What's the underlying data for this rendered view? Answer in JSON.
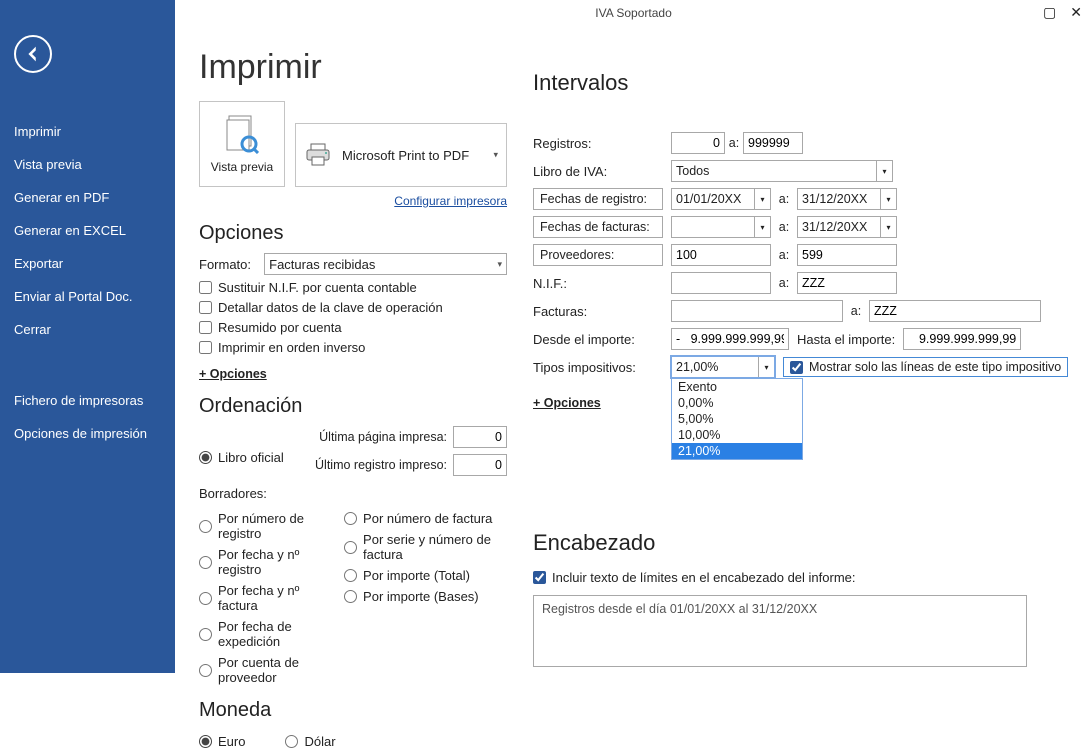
{
  "window": {
    "title": "IVA Soportado"
  },
  "sidebar": {
    "items": [
      {
        "label": "Imprimir"
      },
      {
        "label": "Vista previa"
      },
      {
        "label": "Generar en PDF"
      },
      {
        "label": "Generar en EXCEL"
      },
      {
        "label": "Exportar"
      },
      {
        "label": "Enviar al Portal Doc."
      },
      {
        "label": "Cerrar"
      }
    ],
    "items2": [
      {
        "label": "Fichero de impresoras"
      },
      {
        "label": "Opciones de impresión"
      }
    ]
  },
  "page": {
    "title": "Imprimir",
    "preview_label": "Vista previa",
    "printer_name": "Microsoft Print to PDF",
    "config_printer_link": "Configurar impresora"
  },
  "opciones": {
    "heading": "Opciones",
    "formato_label": "Formato:",
    "formato_value": "Facturas recibidas",
    "checks": [
      "Sustituir N.I.F. por cuenta contable",
      "Detallar datos de la clave de operación",
      "Resumido por cuenta",
      "Imprimir en orden inverso"
    ],
    "more": "+ Opciones"
  },
  "ordenacion": {
    "heading": "Ordenación",
    "libro_oficial": "Libro oficial",
    "ultima_pagina_label": "Última página impresa:",
    "ultima_pagina_value": "0",
    "ultimo_registro_label": "Último registro impreso:",
    "ultimo_registro_value": "0",
    "borradores_label": "Borradores:",
    "col1": [
      "Por número de registro",
      "Por fecha y nº registro",
      "Por fecha y nº factura",
      "Por fecha de expedición",
      "Por cuenta de proveedor"
    ],
    "col2": [
      "Por número de factura",
      "Por serie y número de factura",
      "Por importe (Total)",
      "Por importe (Bases)"
    ]
  },
  "moneda": {
    "heading": "Moneda",
    "euro": "Euro",
    "dolar": "Dólar"
  },
  "intervalos": {
    "heading": "Intervalos",
    "registros_label": "Registros:",
    "registros_from": "0",
    "registros_to": "999999",
    "libro_label": "Libro de IVA:",
    "libro_value": "Todos",
    "fechas_registro_btn": "Fechas de registro:",
    "fechas_registro_from": "01/01/20XX",
    "fechas_registro_to": "31/12/20XX",
    "fechas_facturas_btn": "Fechas de facturas:",
    "fechas_facturas_to": "31/12/20XX",
    "proveedores_btn": "Proveedores:",
    "prov_from": "100",
    "prov_to": "599",
    "nif_label": "N.I.F.:",
    "nif_to": "ZZZ",
    "facturas_label": "Facturas:",
    "facturas_to": "ZZZ",
    "desde_importe_label": "Desde el importe:",
    "desde_importe_value": "-   9.999.999.999,99",
    "hasta_importe_label": "Hasta el importe:",
    "hasta_importe_value": "9.999.999.999,99",
    "tipos_label": "Tipos impositivos:",
    "tipos_value": "21,00%",
    "tipos_options": [
      "Exento",
      "0,00%",
      "5,00%",
      "10,00%",
      "21,00%"
    ],
    "mostrar_label": "Mostrar solo las líneas de este tipo impositivo",
    "a_label": "a:",
    "more": "+ Opciones"
  },
  "encabezado": {
    "heading": "Encabezado",
    "incluir_label": "Incluir texto de límites en el encabezado del informe:",
    "text": "Registros desde el día 01/01/20XX al 31/12/20XX"
  }
}
